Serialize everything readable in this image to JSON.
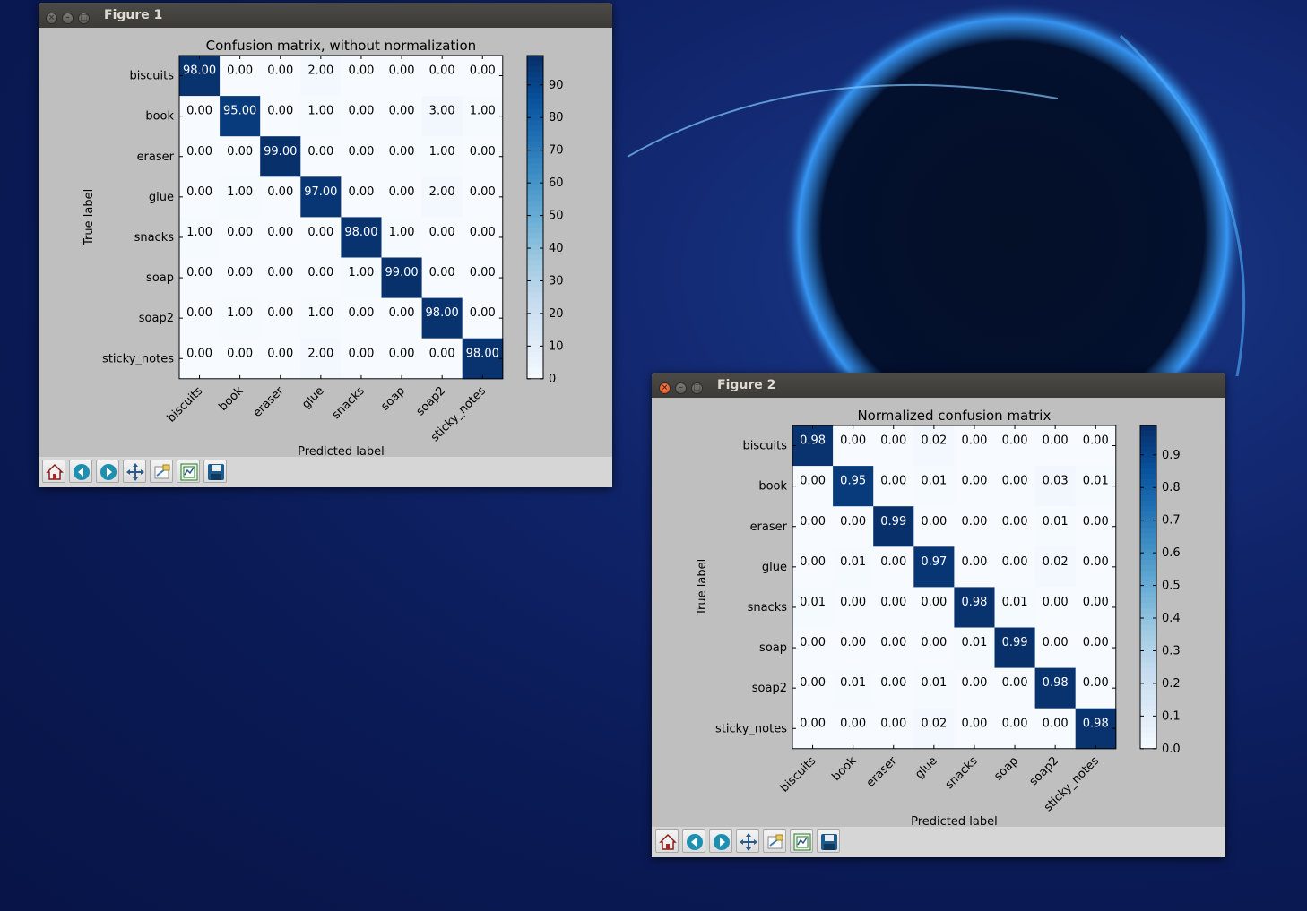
{
  "figure1": {
    "window_title": "Figure 1",
    "chart_data": {
      "type": "heatmap",
      "title": "Confusion matrix, without normalization",
      "xlabel": "Predicted label",
      "ylabel": "True label",
      "labels": [
        "biscuits",
        "book",
        "eraser",
        "glue",
        "snacks",
        "soap",
        "soap2",
        "sticky_notes"
      ],
      "matrix": [
        [
          "98.00",
          "0.00",
          "0.00",
          "2.00",
          "0.00",
          "0.00",
          "0.00",
          "0.00"
        ],
        [
          "0.00",
          "95.00",
          "0.00",
          "1.00",
          "0.00",
          "0.00",
          "3.00",
          "1.00"
        ],
        [
          "0.00",
          "0.00",
          "99.00",
          "0.00",
          "0.00",
          "0.00",
          "1.00",
          "0.00"
        ],
        [
          "0.00",
          "1.00",
          "0.00",
          "97.00",
          "0.00",
          "0.00",
          "2.00",
          "0.00"
        ],
        [
          "1.00",
          "0.00",
          "0.00",
          "0.00",
          "98.00",
          "1.00",
          "0.00",
          "0.00"
        ],
        [
          "0.00",
          "0.00",
          "0.00",
          "0.00",
          "1.00",
          "99.00",
          "0.00",
          "0.00"
        ],
        [
          "0.00",
          "1.00",
          "0.00",
          "1.00",
          "0.00",
          "0.00",
          "98.00",
          "0.00"
        ],
        [
          "0.00",
          "0.00",
          "0.00",
          "2.00",
          "0.00",
          "0.00",
          "0.00",
          "98.00"
        ]
      ],
      "vmin": 0,
      "vmax": 99,
      "colorbar_ticks": [
        "0",
        "10",
        "20",
        "30",
        "40",
        "50",
        "60",
        "70",
        "80",
        "90"
      ],
      "colormap": [
        "#f7fbff",
        "#08306b"
      ]
    }
  },
  "figure2": {
    "window_title": "Figure 2",
    "chart_data": {
      "type": "heatmap",
      "title": "Normalized confusion matrix",
      "xlabel": "Predicted label",
      "ylabel": "True label",
      "labels": [
        "biscuits",
        "book",
        "eraser",
        "glue",
        "snacks",
        "soap",
        "soap2",
        "sticky_notes"
      ],
      "matrix": [
        [
          "0.98",
          "0.00",
          "0.00",
          "0.02",
          "0.00",
          "0.00",
          "0.00",
          "0.00"
        ],
        [
          "0.00",
          "0.95",
          "0.00",
          "0.01",
          "0.00",
          "0.00",
          "0.03",
          "0.01"
        ],
        [
          "0.00",
          "0.00",
          "0.99",
          "0.00",
          "0.00",
          "0.00",
          "0.01",
          "0.00"
        ],
        [
          "0.00",
          "0.01",
          "0.00",
          "0.97",
          "0.00",
          "0.00",
          "0.02",
          "0.00"
        ],
        [
          "0.01",
          "0.00",
          "0.00",
          "0.00",
          "0.98",
          "0.01",
          "0.00",
          "0.00"
        ],
        [
          "0.00",
          "0.00",
          "0.00",
          "0.00",
          "0.01",
          "0.99",
          "0.00",
          "0.00"
        ],
        [
          "0.00",
          "0.01",
          "0.00",
          "0.01",
          "0.00",
          "0.00",
          "0.98",
          "0.00"
        ],
        [
          "0.00",
          "0.00",
          "0.00",
          "0.02",
          "0.00",
          "0.00",
          "0.00",
          "0.98"
        ]
      ],
      "vmin": 0,
      "vmax": 0.99,
      "colorbar_ticks": [
        "0.0",
        "0.1",
        "0.2",
        "0.3",
        "0.4",
        "0.5",
        "0.6",
        "0.7",
        "0.8",
        "0.9"
      ],
      "colormap": [
        "#f7fbff",
        "#08306b"
      ]
    }
  },
  "toolbar": {
    "buttons": [
      {
        "name": "home",
        "icon": "home-icon"
      },
      {
        "name": "back",
        "icon": "arrow-left-icon"
      },
      {
        "name": "forward",
        "icon": "arrow-right-icon"
      },
      {
        "name": "pan",
        "icon": "pan-icon"
      },
      {
        "name": "zoom",
        "icon": "zoom-rect-icon"
      },
      {
        "name": "subplots",
        "icon": "subplots-icon"
      },
      {
        "name": "save",
        "icon": "save-icon"
      }
    ]
  }
}
